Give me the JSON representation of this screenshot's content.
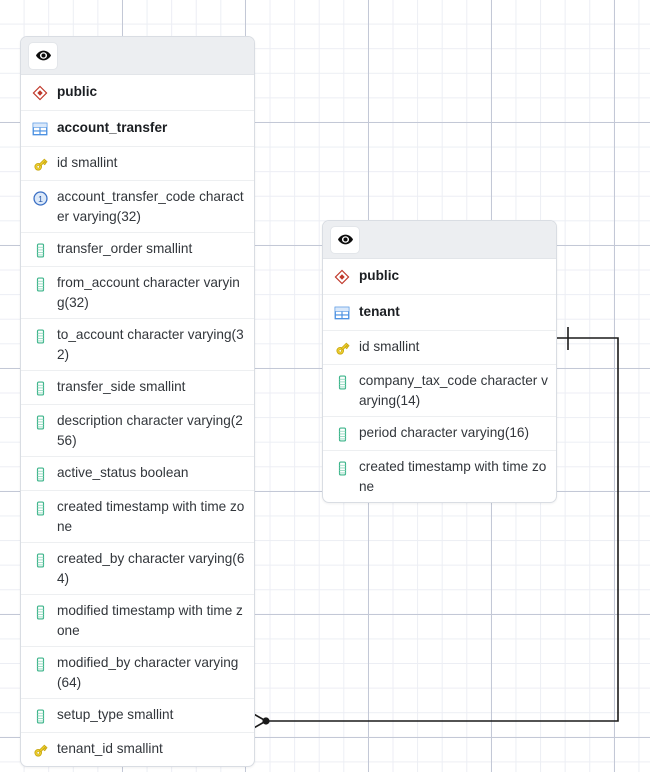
{
  "canvas": {
    "grid": {
      "minor_color": "#eceef4",
      "major_color": "#c3c8d6",
      "minor_step": 24.6,
      "major_step": 123
    },
    "background": "#ffffff"
  },
  "colors": {
    "schema_icon": "#c0392b",
    "table_icon": "#4a90e2",
    "key_icon": "#e8c10c",
    "index_icon": "#4a7fd4",
    "column_icon": "#3cb48a",
    "link_line": "#1a1a1a",
    "header_bg": "#eceef1",
    "border": "#d9dde3"
  },
  "entities": [
    {
      "id": "account_transfer",
      "header": {
        "visibility_icon": "eye-icon",
        "title": ""
      },
      "schema": {
        "icon": "schema-diamond-icon",
        "label": "public"
      },
      "table": {
        "icon": "table-grid-icon",
        "label": "account_transfer"
      },
      "columns": [
        {
          "icon": "primary-key-icon",
          "label": "id smallint"
        },
        {
          "icon": "unique-index-icon",
          "label": "account_transfer_code character varying(32)"
        },
        {
          "icon": "column-icon",
          "label": "transfer_order smallint"
        },
        {
          "icon": "column-icon",
          "label": "from_account character varying(32)"
        },
        {
          "icon": "column-icon",
          "label": "to_account character varying(32)"
        },
        {
          "icon": "column-icon",
          "label": "transfer_side smallint"
        },
        {
          "icon": "column-icon",
          "label": "description character varying(256)"
        },
        {
          "icon": "column-icon",
          "label": "active_status boolean"
        },
        {
          "icon": "column-icon",
          "label": "created timestamp with time zone"
        },
        {
          "icon": "column-icon",
          "label": "created_by character varying(64)"
        },
        {
          "icon": "column-icon",
          "label": "modified timestamp with time zone"
        },
        {
          "icon": "column-icon",
          "label": "modified_by character varying(64)"
        },
        {
          "icon": "column-icon",
          "label": "setup_type smallint"
        },
        {
          "icon": "foreign-key-icon",
          "label": "tenant_id smallint"
        }
      ]
    },
    {
      "id": "tenant",
      "header": {
        "visibility_icon": "eye-icon",
        "title": ""
      },
      "schema": {
        "icon": "schema-diamond-icon",
        "label": "public"
      },
      "table": {
        "icon": "table-grid-icon",
        "label": "tenant"
      },
      "columns": [
        {
          "icon": "primary-key-icon",
          "label": "id smallint"
        },
        {
          "icon": "column-icon",
          "label": "company_tax_code character varying(14)"
        },
        {
          "icon": "column-icon",
          "label": "period character varying(16)"
        },
        {
          "icon": "column-icon",
          "label": "created timestamp with time zone"
        }
      ]
    }
  ],
  "relationships": [
    {
      "id": "account_transfer-tenant-fk",
      "from": "account_transfer.tenant_id",
      "to": "tenant.id",
      "from_notation": "crows-foot-many",
      "to_notation": "one-tick"
    }
  ]
}
